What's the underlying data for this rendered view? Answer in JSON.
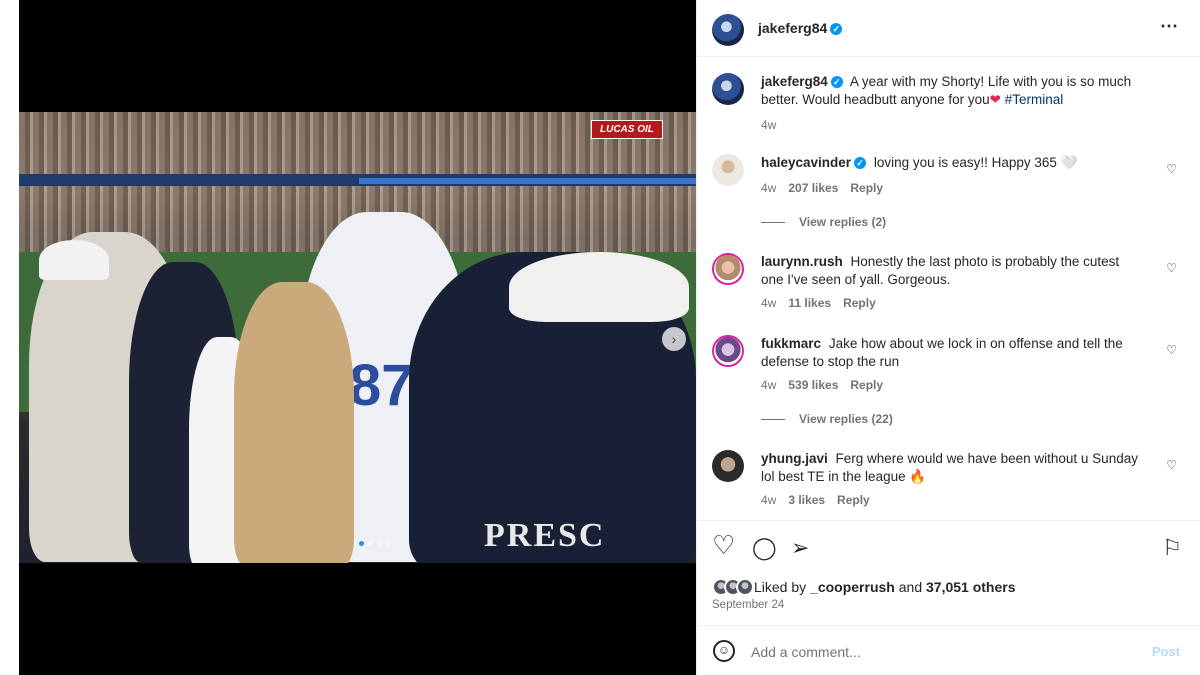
{
  "post": {
    "author": "jakeferg84",
    "more_icon": "⋯",
    "verified_icon": "✓"
  },
  "media": {
    "stadium_sign": "LUCAS OIL",
    "jersey_number": "87",
    "jersey_text": "PRESC",
    "next_icon": "›",
    "carousel_total": 4,
    "carousel_active": 1
  },
  "caption": {
    "username": "jakeferg84",
    "text": "A year with my Shorty! Life with you is so much better. Would headbutt anyone for you",
    "heart": "❤",
    "hashtag": "#Terminal",
    "time": "4w"
  },
  "comments": [
    {
      "username": "haleycavinder",
      "verified": true,
      "text": "loving you is easy!! Happy 365 🤍",
      "time": "4w",
      "likes": "207 likes",
      "reply": "Reply",
      "view_replies": "View replies (2)"
    },
    {
      "username": "laurynn.rush",
      "verified": false,
      "text": "Honestly the last photo is probably the cutest one I've seen of yall. Gorgeous.",
      "time": "4w",
      "likes": "11 likes",
      "reply": "Reply"
    },
    {
      "username": "fukkmarc",
      "verified": false,
      "text": "Jake how about we lock in on offense and tell the defense to stop the run",
      "time": "4w",
      "likes": "539 likes",
      "reply": "Reply",
      "view_replies": "View replies (22)"
    },
    {
      "username": "yhung.javi",
      "verified": false,
      "text": "Ferg where would we have been without u Sunday lol best TE in the league 🔥",
      "time": "4w",
      "likes": "3 likes",
      "reply": "Reply"
    }
  ],
  "actions": {
    "heart_icon": "♡",
    "comment_icon": "◯",
    "share_icon": "➢",
    "save_icon": "⚐",
    "liked_by_prefix": "Liked by",
    "liked_by_user": "_cooperrush",
    "liked_by_and": "and",
    "liked_by_others": "37,051 others",
    "date": "September 24"
  },
  "add_comment": {
    "emoji_icon": "☺",
    "placeholder": "Add a comment...",
    "post_label": "Post"
  }
}
